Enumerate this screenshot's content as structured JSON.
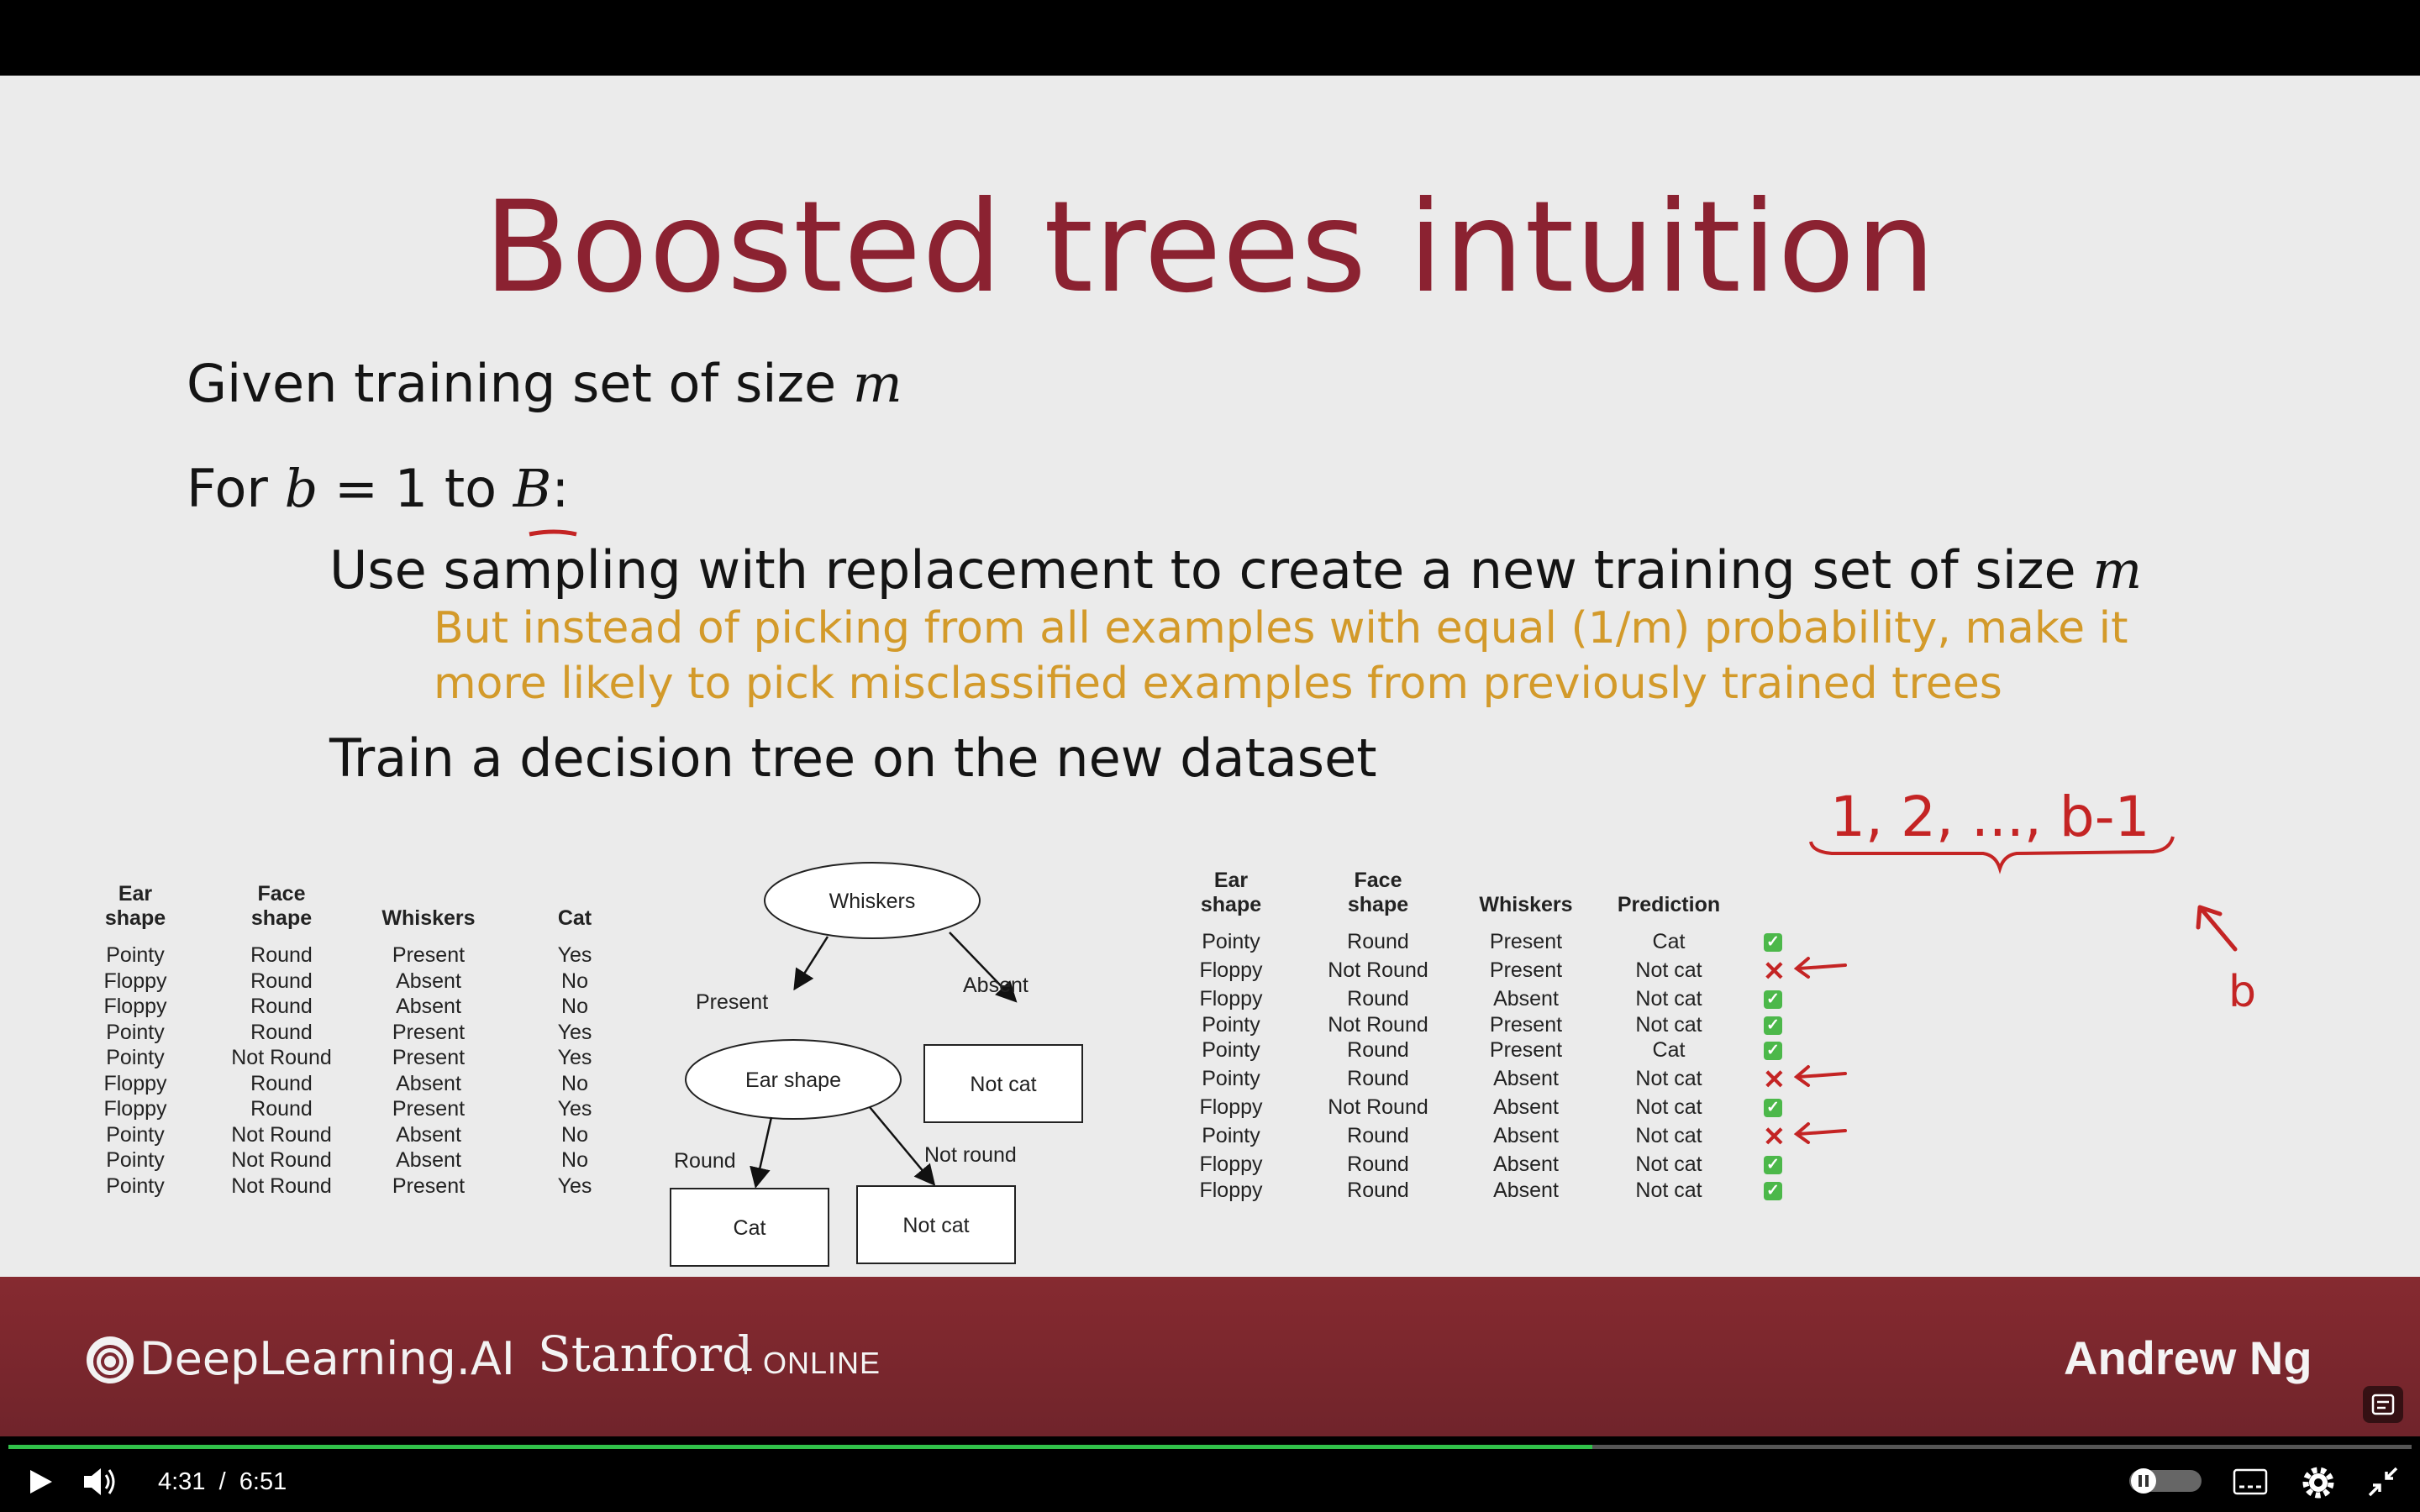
{
  "slide": {
    "title": "Boosted trees intuition",
    "given": {
      "text": "Given training set of size ",
      "var": "m"
    },
    "for_loop": {
      "prefix": "For ",
      "b": "b",
      "mid": " = 1 to ",
      "B": "B",
      "colon": ":"
    },
    "step1": {
      "text": "Use sampling with replacement to create a new training set of size ",
      "var": "m"
    },
    "note_line1": "But instead of picking from all examples with equal (1/m) probability, make it",
    "note_line2": "more likely to pick misclassified examples from previously trained trees",
    "step2": "Train a decision tree on the new dataset",
    "handwriting": {
      "sequence": "1, 2, ..., b-1",
      "b": "b"
    }
  },
  "left_table": {
    "headers": [
      [
        "Ear",
        "shape"
      ],
      [
        "Face",
        "shape"
      ],
      [
        "Whiskers"
      ],
      [
        "Cat"
      ]
    ],
    "rows": [
      [
        "Pointy",
        "Round",
        "Present",
        "Yes"
      ],
      [
        "Floppy",
        "Round",
        "Absent",
        "No"
      ],
      [
        "Floppy",
        "Round",
        "Absent",
        "No"
      ],
      [
        "Pointy",
        "Round",
        "Present",
        "Yes"
      ],
      [
        "Pointy",
        "Not Round",
        "Present",
        "Yes"
      ],
      [
        "Floppy",
        "Round",
        "Absent",
        "No"
      ],
      [
        "Floppy",
        "Round",
        "Present",
        "Yes"
      ],
      [
        "Pointy",
        "Not Round",
        "Absent",
        "No"
      ],
      [
        "Pointy",
        "Not Round",
        "Absent",
        "No"
      ],
      [
        "Pointy",
        "Not Round",
        "Present",
        "Yes"
      ]
    ]
  },
  "tree": {
    "root": "Whiskers",
    "present_edge": "Present",
    "absent_edge": "Absent",
    "ear_node": "Ear shape",
    "leaf_notcat_right": "Not cat",
    "round_edge": "Round",
    "notround_edge": "Not round",
    "leaf_cat": "Cat",
    "leaf_notcat": "Not cat"
  },
  "right_table": {
    "headers": [
      [
        "Ear",
        "shape"
      ],
      [
        "Face",
        "shape"
      ],
      [
        "Whiskers"
      ],
      [
        "Prediction"
      ]
    ],
    "rows": [
      {
        "cells": [
          "Pointy",
          "Round",
          "Present",
          "Cat"
        ],
        "correct": true
      },
      {
        "cells": [
          "Floppy",
          "Not Round",
          "Present",
          "Not cat"
        ],
        "correct": false
      },
      {
        "cells": [
          "Floppy",
          "Round",
          "Absent",
          "Not cat"
        ],
        "correct": true
      },
      {
        "cells": [
          "Pointy",
          "Not Round",
          "Present",
          "Not cat"
        ],
        "correct": true
      },
      {
        "cells": [
          "Pointy",
          "Round",
          "Present",
          "Cat"
        ],
        "correct": true
      },
      {
        "cells": [
          "Pointy",
          "Round",
          "Absent",
          "Not cat"
        ],
        "correct": false
      },
      {
        "cells": [
          "Floppy",
          "Not Round",
          "Absent",
          "Not cat"
        ],
        "correct": true
      },
      {
        "cells": [
          "Pointy",
          "Round",
          "Absent",
          "Not cat"
        ],
        "correct": false
      },
      {
        "cells": [
          "Floppy",
          "Round",
          "Absent",
          "Not cat"
        ],
        "correct": true
      },
      {
        "cells": [
          "Floppy",
          "Round",
          "Absent",
          "Not cat"
        ],
        "correct": true
      }
    ]
  },
  "footer": {
    "brand1": "DeepLearning.AI",
    "brand2_main": "Stanford",
    "brand2_sub": "ONLINE",
    "presenter": "Andrew Ng"
  },
  "player": {
    "current_time": "4:31",
    "separator": "/",
    "duration": "6:51",
    "progress": 0.659,
    "colors": {
      "progress": "#31c24a",
      "title": "#8b2231",
      "note": "#d39a2a",
      "ink": "#c42424"
    }
  }
}
